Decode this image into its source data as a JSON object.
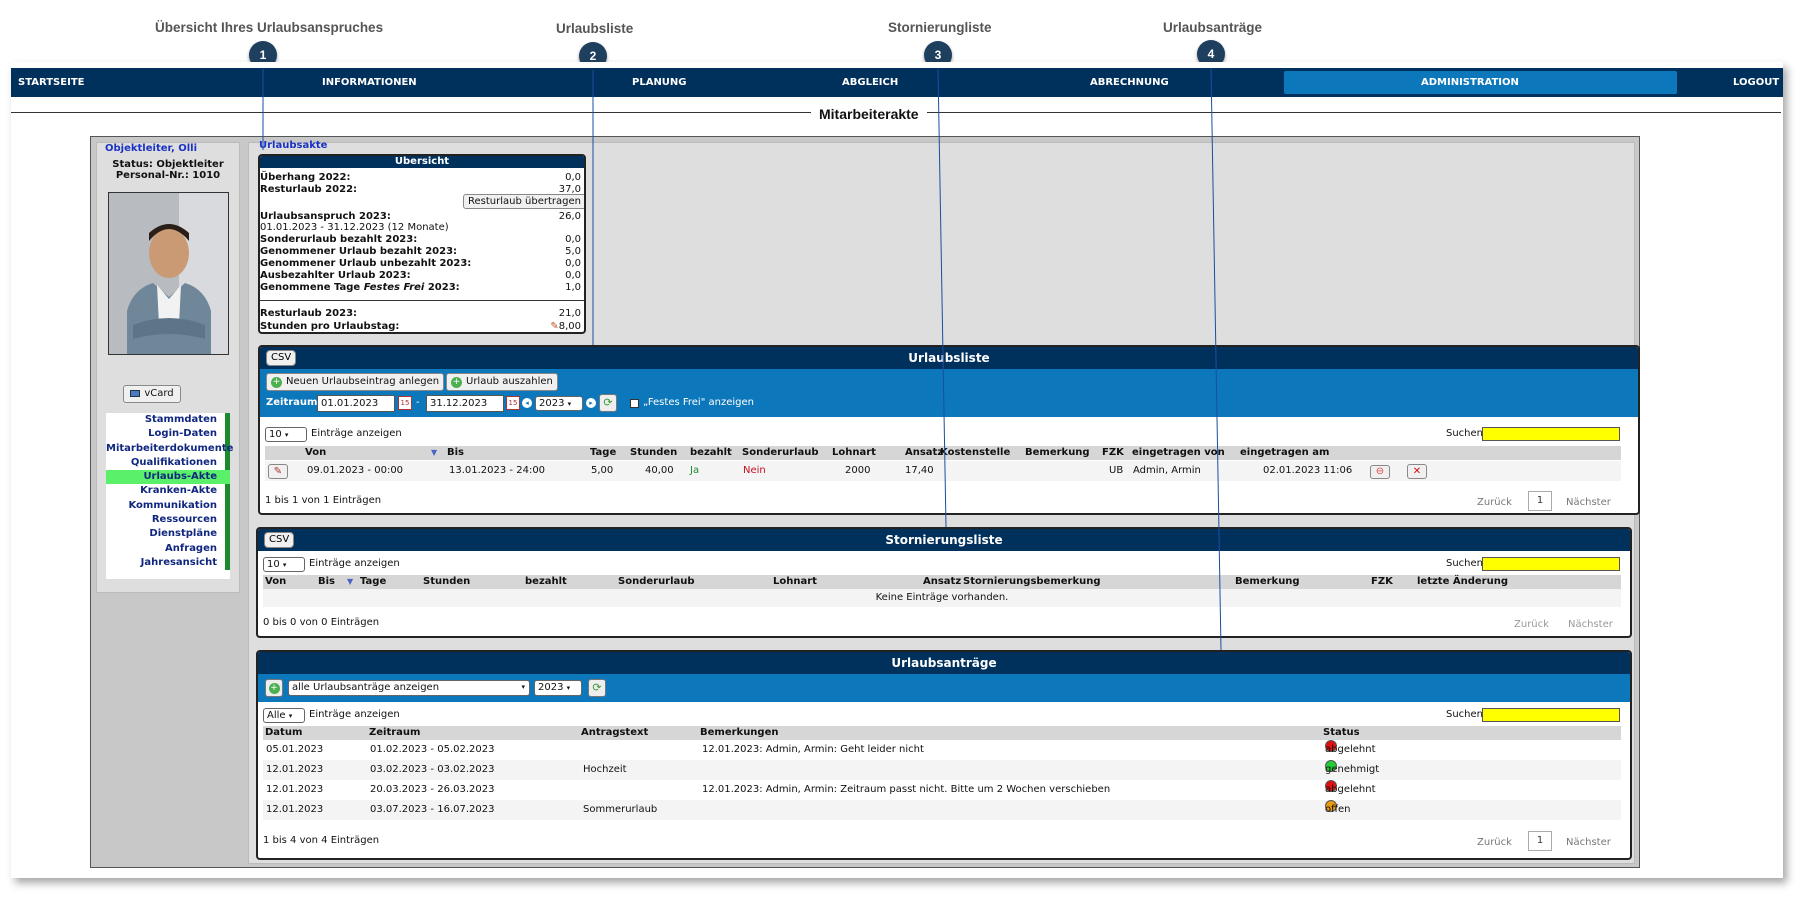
{
  "callouts": [
    {
      "num": "1",
      "label": "Übersicht Ihres Urlaubsanspruches"
    },
    {
      "num": "2",
      "label": "Urlaubsliste"
    },
    {
      "num": "3",
      "label": "Stornierungliste"
    },
    {
      "num": "4",
      "label": "Urlaubsanträge"
    }
  ],
  "nav": {
    "items": [
      "STARTSEITE",
      "INFORMATIONEN",
      "PLANUNG",
      "ABGLEICH",
      "ABRECHNUNG",
      "ADMINISTRATION",
      "LOGOUT"
    ],
    "active": "ADMINISTRATION"
  },
  "page_title": "Mitarbeiterakte",
  "employee": {
    "name": "Objektleiter, Olli",
    "status": "Status: Objektleiter",
    "personal_nr": "Personal-Nr.: 1010",
    "vcard": "vCard"
  },
  "menu": [
    "Stammdaten",
    "Login-Daten",
    "Mitarbeiterdokumente",
    "Qualifikationen",
    "Urlaubs-Akte",
    "Kranken-Akte",
    "Kommunikation",
    "Ressourcen",
    "Dienstpläne",
    "Anfragen",
    "Jahresansicht"
  ],
  "menu_active": "Urlaubs-Akte",
  "breadcrumb": "Urlaubsakte",
  "overview": {
    "title": "Übersicht",
    "ueberhang_label": "Überhang 2022:",
    "ueberhang": "0,0",
    "resturlaub_prev_label": "Resturlaub 2022:",
    "resturlaub_prev": "37,0",
    "transfer_button": "Resturlaub übertragen",
    "anspruch_label": "Urlaubsanspruch 2023:",
    "anspruch": "26,0",
    "period": "01.01.2023 - 31.12.2023 (12 Monate)",
    "sonder_label": "Sonderurlaub bezahlt 2023:",
    "sonder": "0,0",
    "genommen_bez_label": "Genommener Urlaub bezahlt 2023:",
    "genommen_bez": "5,0",
    "genommen_unbez_label": "Genommener Urlaub unbezahlt 2023:",
    "genommen_unbez": "0,0",
    "ausbezahlt_label": "Ausbezahlter Urlaub 2023:",
    "ausbezahlt": "0,0",
    "festes_frei_label_a": "Genommene Tage ",
    "festes_frei_label_b": "Festes Frei",
    "festes_frei_label_c": " 2023:",
    "festes_frei": "1,0",
    "resturlaub_label": "Resturlaub 2023:",
    "resturlaub": "21,0",
    "stunden_label": "Stunden pro Urlaubstag:",
    "stunden": "8,00"
  },
  "urlaubsliste": {
    "csv": "CSV",
    "title": "Urlaubsliste",
    "new_button": "Neuen Urlaubseintrag anlegen",
    "pay_button": "Urlaub auszahlen",
    "zeitraum_label": "Zeitraum:",
    "date_from": "01.01.2023",
    "date_sep": "-",
    "date_to": "31.12.2023",
    "year": "2023",
    "festes_frei_check": "„Festes Frei\" anzeigen",
    "page_size": "10",
    "entries_label": "Einträge anzeigen",
    "search_label": "Suchen",
    "columns": [
      "Von",
      "Bis",
      "Tage",
      "Stunden",
      "bezahlt",
      "Sonderurlaub",
      "Lohnart",
      "Ansatz",
      "Kostenstelle",
      "Bemerkung",
      "FZK",
      "eingetragen von",
      "eingetragen am"
    ],
    "rows": [
      {
        "von": "09.01.2023 - 00:00",
        "bis": "13.01.2023 - 24:00",
        "tage": "5,00",
        "stunden": "40,00",
        "bezahlt": "Ja",
        "sonder": "Nein",
        "lohnart": "2000",
        "ansatz": "17,40",
        "kostenstelle": "",
        "bemerkung": "",
        "fzk": "UB",
        "von_user": "Admin, Armin",
        "am": "02.01.2023 11:06"
      }
    ],
    "info": "1 bis 1 von 1 Einträgen",
    "prev": "Zurück",
    "page": "1",
    "next": "Nächster"
  },
  "stornierungsliste": {
    "csv": "CSV",
    "title": "Stornierungsliste",
    "page_size": "10",
    "entries_label": "Einträge anzeigen",
    "search_label": "Suchen",
    "columns": [
      "Von",
      "Bis",
      "Tage",
      "Stunden",
      "bezahlt",
      "Sonderurlaub",
      "Lohnart",
      "Ansatz",
      "Stornierungsbemerkung",
      "Bemerkung",
      "FZK",
      "letzte Änderung"
    ],
    "empty": "Keine Einträge vorhanden.",
    "info": "0 bis 0 von 0 Einträgen",
    "prev": "Zurück",
    "next": "Nächster"
  },
  "urlaubsantraege": {
    "title": "Urlaubsanträge",
    "filter": "alle Urlaubsanträge anzeigen",
    "year": "2023",
    "page_size": "Alle",
    "entries_label": "Einträge anzeigen",
    "search_label": "Suchen",
    "columns": [
      "Datum",
      "Zeitraum",
      "Antragstext",
      "Bemerkungen",
      "Status"
    ],
    "rows": [
      {
        "datum": "05.01.2023",
        "zeitraum": "01.02.2023 - 05.02.2023",
        "text": "",
        "bemerkung": "12.01.2023: Admin, Armin: Geht leider nicht",
        "status": "abgelehnt",
        "color": "#e01010"
      },
      {
        "datum": "12.01.2023",
        "zeitraum": "03.02.2023 - 03.02.2023",
        "text": "Hochzeit",
        "bemerkung": "",
        "status": "genehmigt",
        "color": "#22cc33"
      },
      {
        "datum": "12.01.2023",
        "zeitraum": "20.03.2023 - 26.03.2023",
        "text": "",
        "bemerkung": "12.01.2023: Admin, Armin: Zeitraum passt nicht. Bitte um 2 Wochen verschieben",
        "status": "abgelehnt",
        "color": "#e01010"
      },
      {
        "datum": "12.01.2023",
        "zeitraum": "03.07.2023 - 16.07.2023",
        "text": "Sommerurlaub",
        "bemerkung": "",
        "status": "offen",
        "color": "#e89a10"
      }
    ],
    "info": "1 bis 4 von 4 Einträgen",
    "prev": "Zurück",
    "page": "1",
    "next": "Nächster"
  },
  "colors": {
    "nav": "#00305c",
    "toolbar": "#0d77bb",
    "search": "#ffff00",
    "menu_active": "#5af06a",
    "ja": "#1b8a2f",
    "nein": "#c01020"
  }
}
